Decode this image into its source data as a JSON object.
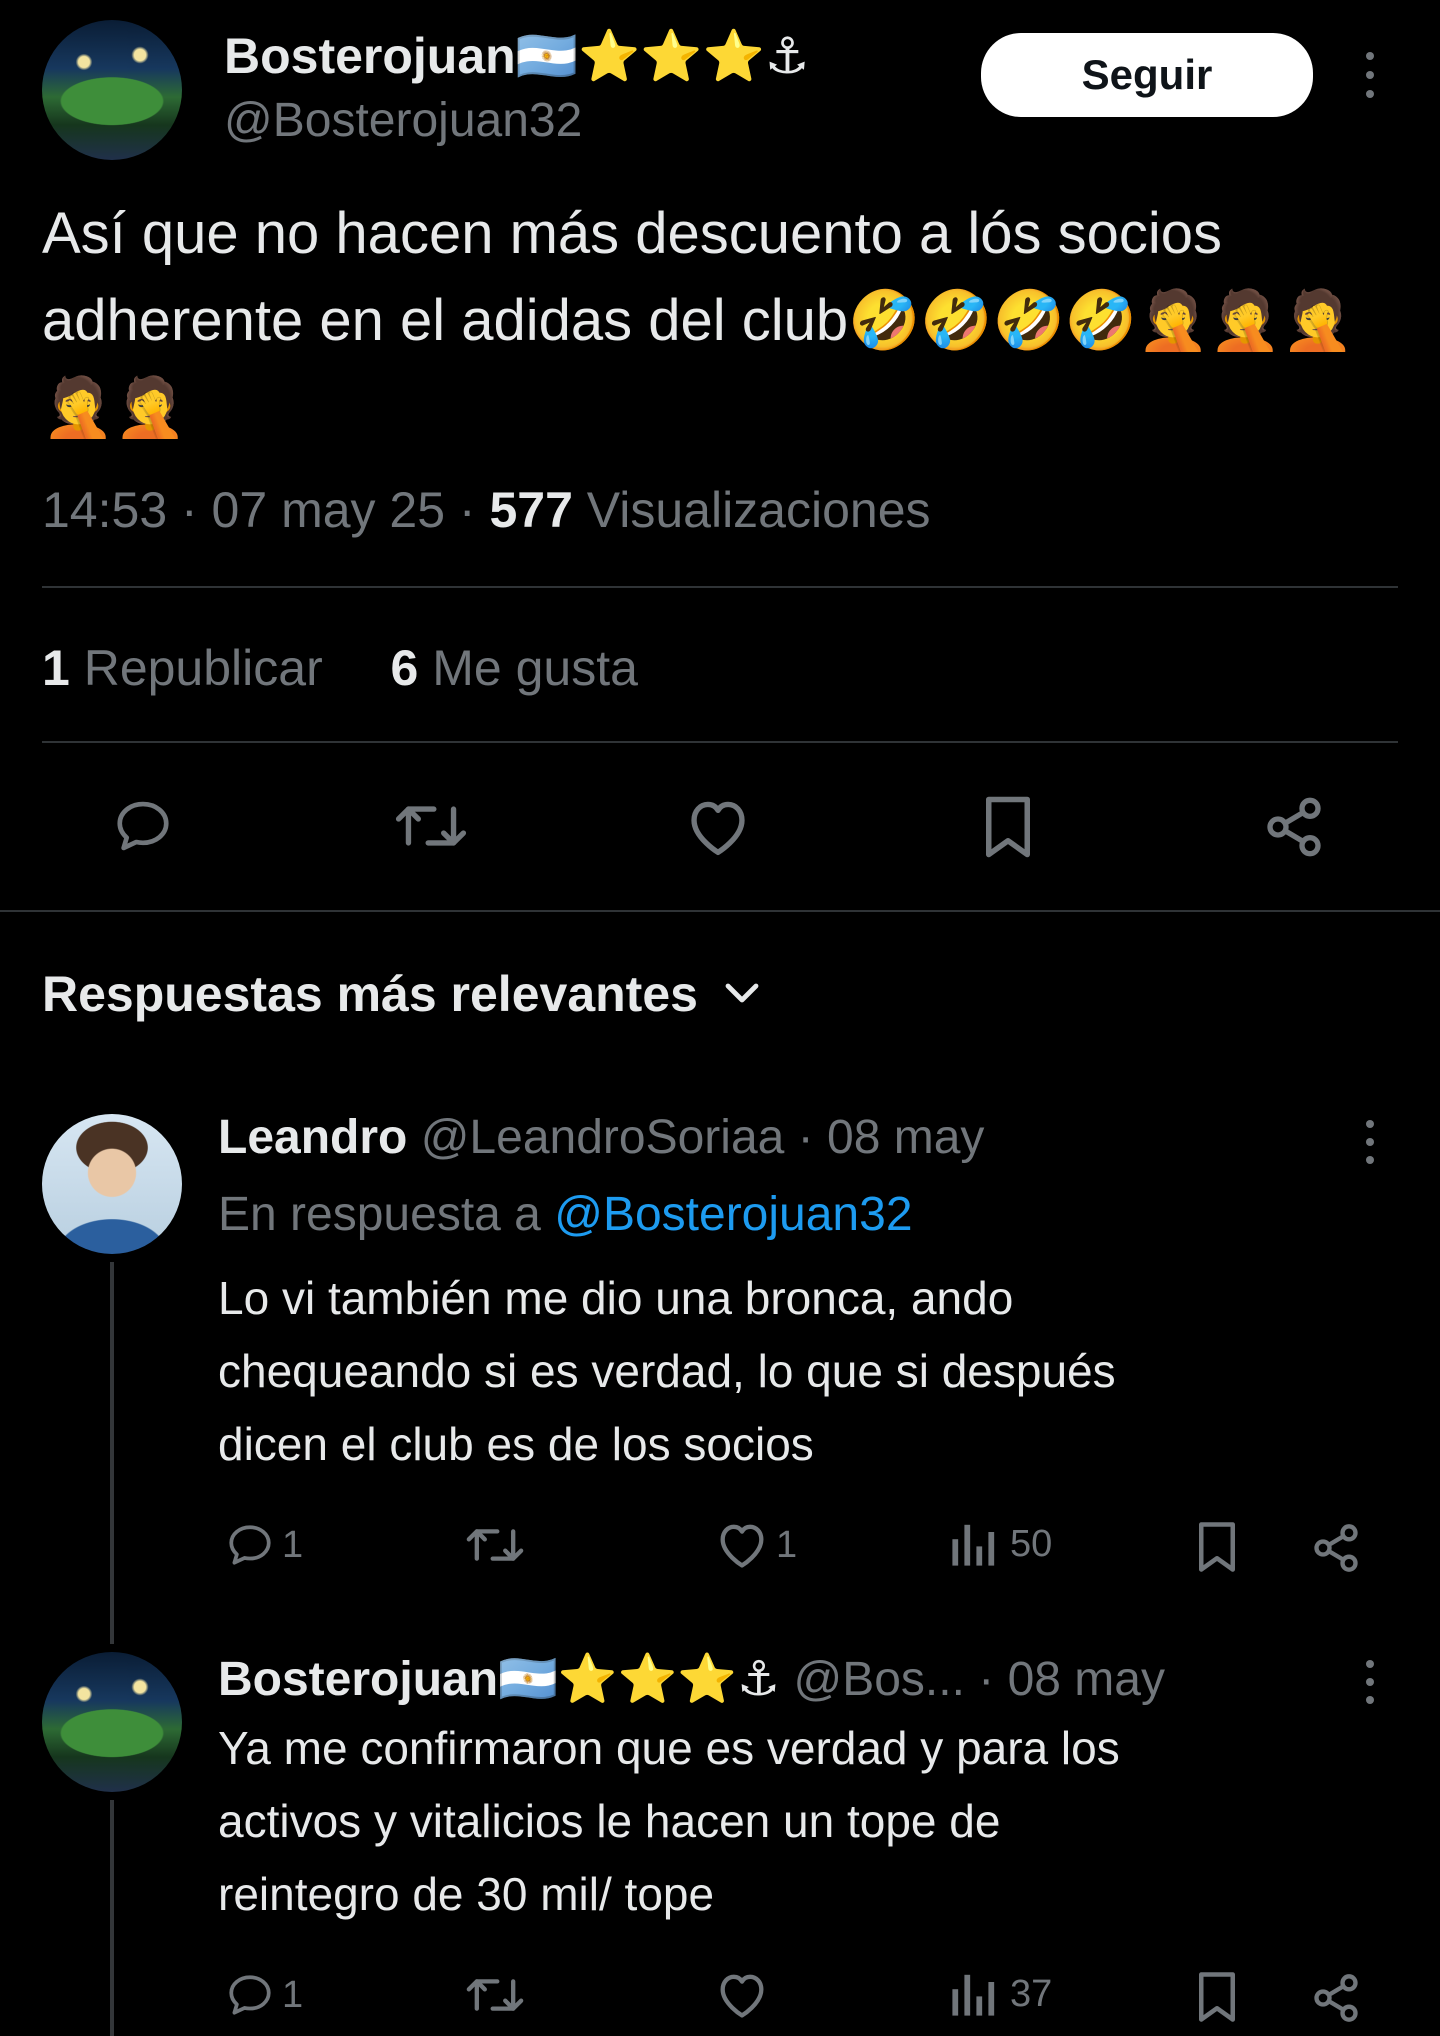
{
  "tweet": {
    "author_name": "Bosterojuan🇦🇷⭐⭐⭐⚓",
    "author_handle": "@Bosterojuan32",
    "follow_label": "Seguir",
    "text": "Así que  no hacen más descuento a lós socios adherente en el adidas del club🤣🤣🤣🤣🤦🤦🤦🤦🤦",
    "time": "14:53 · 07 may 25 · ",
    "views_count": "577",
    "views_label": " Visualizaciones",
    "reposts_count": "1",
    "reposts_label": " Republicar",
    "likes_count": "6",
    "likes_label": " Me gusta"
  },
  "replies_header": {
    "label": "Respuestas más relevantes"
  },
  "replies": [
    {
      "name": "Leandro",
      "handle": "@LeandroSoriaa",
      "date": " · 08 may",
      "replying_prefix": "En respuesta a ",
      "replying_to": "@Bosterojuan32",
      "text": "Lo vi también me dio una bronca, ando\nchequeando si es verdad, lo que si después\ndicen el club es de los socios",
      "replies": "1",
      "reposts": "",
      "likes": "1",
      "views": "50"
    },
    {
      "name": "Bosterojuan🇦🇷⭐⭐⭐⚓",
      "handle": "@Bos...",
      "date": " · 08 may",
      "text": "Ya me confirmaron que es verdad y para los\nactivos y vitalicios  le hacen  un tope de\nreintegro de 30 mil/ tope",
      "replies": "1",
      "reposts": "",
      "likes": "",
      "views": "37"
    }
  ],
  "colors": {
    "background": "#000000",
    "text": "#e7e9ea",
    "muted": "#71767b",
    "link": "#1d9bf0",
    "divider": "#2f3336"
  }
}
